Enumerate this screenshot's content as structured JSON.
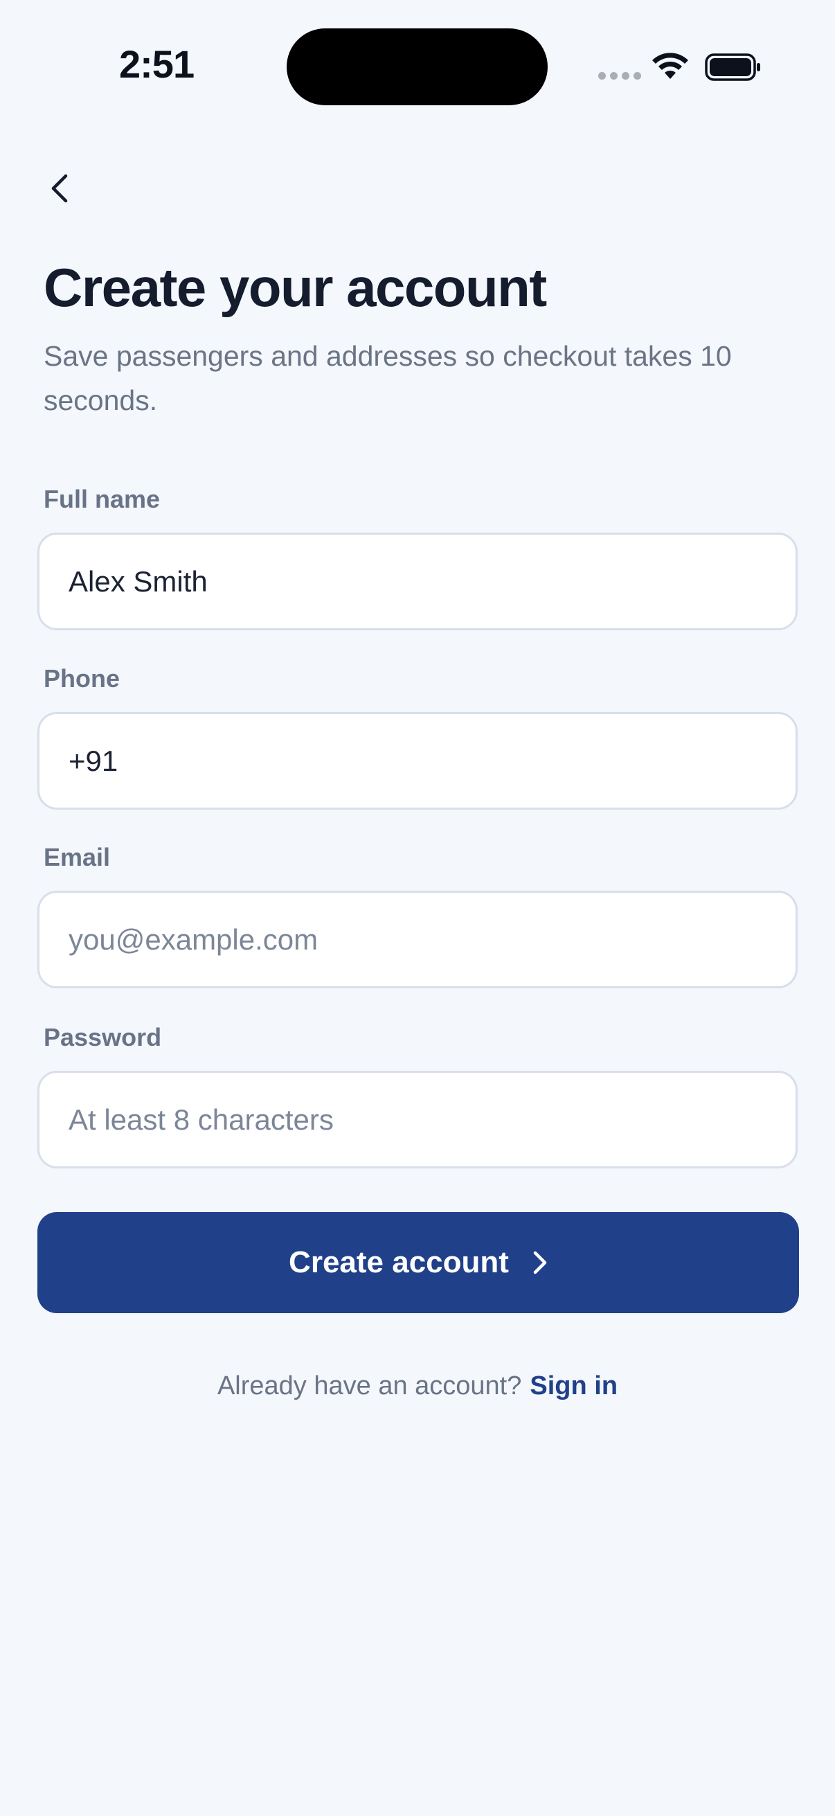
{
  "status_bar": {
    "time": "2:51"
  },
  "header": {
    "back_icon": "chevron-left-icon"
  },
  "intro": {
    "title": "Create your account",
    "subtitle": "Save passengers and addresses so checkout takes 10 seconds."
  },
  "form": {
    "full_name": {
      "label": "Full name",
      "value": "Alex Smith",
      "placeholder": ""
    },
    "phone": {
      "label": "Phone",
      "value": "+91",
      "placeholder": ""
    },
    "email": {
      "label": "Email",
      "value": "",
      "placeholder": "you@example.com"
    },
    "password": {
      "label": "Password",
      "value": "",
      "placeholder": "At least 8 characters"
    },
    "submit_label": "Create account",
    "submit_icon": "chevron-right-icon"
  },
  "footer": {
    "prompt": "Already have an account?",
    "link_label": "Sign in"
  },
  "colors": {
    "background": "#f4f7fb",
    "primary": "#20418a",
    "title": "#141c2e",
    "muted_text": "#6a7486",
    "field_border": "#d8dfea"
  }
}
